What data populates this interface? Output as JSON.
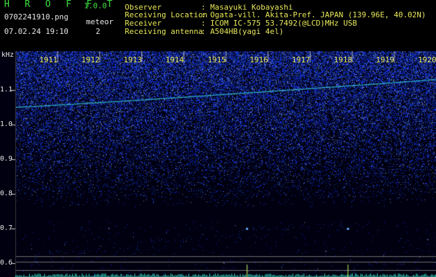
{
  "app": {
    "title": "H R O F F T",
    "version": "1.0.0"
  },
  "file": {
    "name": "0702241910.png",
    "datetime": "07.02.24 19:10"
  },
  "meteor": {
    "label": "meteor",
    "count": "2"
  },
  "info": [
    {
      "label": "Observer",
      "value": ": Masayuki Kobayashi"
    },
    {
      "label": "Receiving Location",
      "value": ": Ogata-vill. Akita-Pref. JAPAN (139.96E, 40.02N)"
    },
    {
      "label": "Receiver",
      "value": ": ICOM IC-575 53.7492(@LCD)MHz USB"
    },
    {
      "label": "Receiving antenna",
      "value": ": A504HB(yagi 4el)"
    }
  ],
  "axis": {
    "unit": "kHz",
    "y_ticks": [
      "1.1",
      "1.0",
      "0.9",
      "0.8",
      "0.7",
      "0.6"
    ],
    "x_ticks": [
      "1911",
      "1912",
      "1913",
      "1914",
      "1915",
      "1916",
      "1917",
      "1918",
      "1919",
      "1920"
    ]
  },
  "colors": {
    "green": "#3fe23f",
    "yellow": "#e8e85a",
    "noise": "#2a3cff",
    "carrier": "#35d0e0"
  },
  "chart_data": {
    "type": "heatmap",
    "xlabel": "",
    "ylabel": "kHz",
    "x_range": [
      1910,
      1920
    ],
    "y_range": [
      0.59,
      1.17
    ],
    "x_ticks": [
      1911,
      1912,
      1913,
      1914,
      1915,
      1916,
      1917,
      1918,
      1919,
      1920
    ],
    "y_ticks": [
      1.1,
      1.0,
      0.9,
      0.8,
      0.7,
      0.6
    ],
    "carrier_line": {
      "x": [
        1910,
        1920
      ],
      "y": [
        1.05,
        1.13
      ]
    },
    "meteor_echoes": [
      {
        "x": 1915.5,
        "y": 0.7
      },
      {
        "x": 1917.9,
        "y": 0.7
      }
    ]
  }
}
